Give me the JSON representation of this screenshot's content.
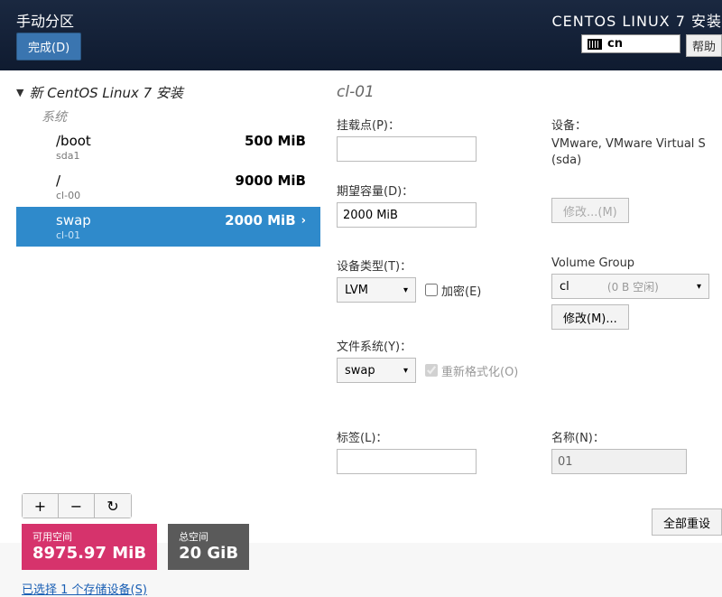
{
  "header": {
    "title": "手动分区",
    "done_btn": "完成(D)",
    "product": "CENTOS LINUX 7 安装",
    "keyboard_layout": "cn",
    "help_btn": "帮助"
  },
  "tree": {
    "root_label": "新 CentOS Linux 7 安装",
    "system_label": "系统",
    "partitions": [
      {
        "name": "/boot",
        "dev": "sda1",
        "size": "500 MiB",
        "selected": false
      },
      {
        "name": "/",
        "dev": "cl-00",
        "size": "9000 MiB",
        "selected": false
      },
      {
        "name": "swap",
        "dev": "cl-01",
        "size": "2000 MiB",
        "selected": true
      }
    ]
  },
  "buttons_bar": {
    "add": "+",
    "remove": "−",
    "reload": "↻"
  },
  "space": {
    "avail_label": "可用空间",
    "avail_value": "8975.97 MiB",
    "total_label": "总空间",
    "total_value": "20 GiB"
  },
  "storage_link": "已选择 1 个存储设备(S)",
  "right": {
    "title": "cl-01",
    "mountpoint_label": "挂载点(P)：",
    "mountpoint_value": "",
    "device_label": "设备：",
    "device_text": "VMware, VMware Virtual S (sda)",
    "modify_btn_disabled": "修改...(M)",
    "capacity_label": "期望容量(D)：",
    "capacity_value": "2000 MiB",
    "devtype_label": "设备类型(T)：",
    "devtype_value": "LVM",
    "encrypt_label": "加密(E)",
    "vg_label": "Volume Group",
    "vg_value": "cl",
    "vg_free": "(0 B 空闲)",
    "modify_btn": "修改(M)...",
    "fs_label": "文件系统(Y)：",
    "fs_value": "swap",
    "reformat_label": "重新格式化(O)",
    "label_label": "标签(L)：",
    "label_value": "",
    "name_label": "名称(N)：",
    "name_value": "01",
    "reset_btn": "全部重设"
  }
}
